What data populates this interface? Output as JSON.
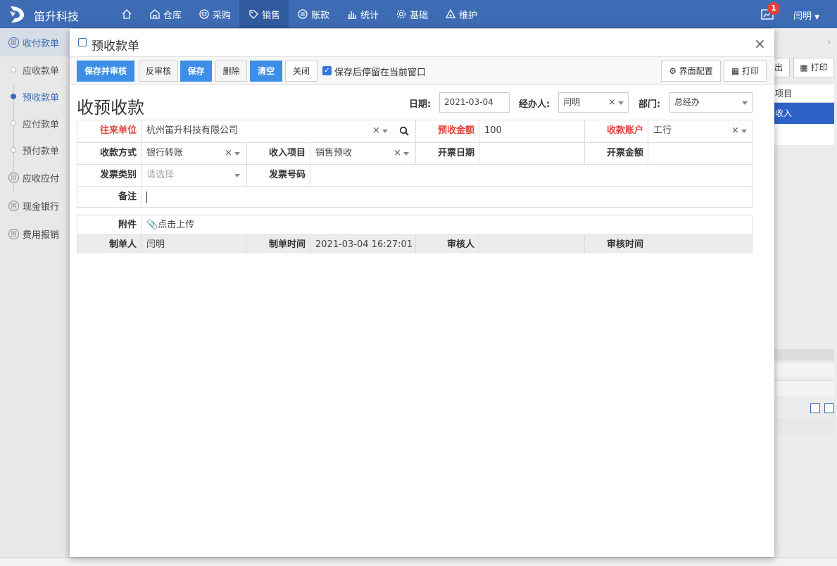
{
  "app": {
    "brand": "笛升科技",
    "badge_count": "1",
    "user_name": "闫明"
  },
  "nav": [
    {
      "label": "",
      "icon": "home-icon"
    },
    {
      "label": "仓库",
      "icon": "warehouse-icon"
    },
    {
      "label": "采购",
      "icon": "purchase-icon"
    },
    {
      "label": "销售",
      "icon": "sales-icon",
      "active": true
    },
    {
      "label": "账款",
      "icon": "account-icon"
    },
    {
      "label": "统计",
      "icon": "stats-icon"
    },
    {
      "label": "基础",
      "icon": "gear-icon"
    },
    {
      "label": "维护",
      "icon": "maintain-icon"
    }
  ],
  "sidebar": {
    "groups": [
      {
        "label": "收付款单",
        "icon_text": "囯"
      },
      {
        "label": "应收应付",
        "icon_text": "囯"
      },
      {
        "label": "现金银行",
        "icon_text": "囯"
      },
      {
        "label": "费用报销",
        "icon_text": "囯"
      }
    ],
    "sub_items": [
      {
        "label": "应收款单"
      },
      {
        "label": "预收款单"
      },
      {
        "label": "应付款单"
      },
      {
        "label": "预付款单"
      }
    ]
  },
  "background": {
    "export_label": "出",
    "print_label": "打印",
    "head_label": "项目",
    "selected_label": "收入"
  },
  "dialog": {
    "title": "预收款单",
    "close_glyph": "×",
    "toolbar": {
      "save_and_audit": "保存并审核",
      "unaudit": "反审核",
      "save": "保存",
      "delete": "删除",
      "clear": "清空",
      "close": "关闭",
      "stay_after_save": "保存后停留在当前窗口",
      "stay_after_save_checked": true,
      "ui_config": "界面配置",
      "print": "打印"
    },
    "form_title": "收预收款",
    "header": {
      "date_label": "日期:",
      "date_value": "2021-03-04",
      "handler_label": "经办人:",
      "handler_value": "闫明",
      "dept_label": "部门:",
      "dept_value": "总经办"
    },
    "fields": {
      "partner_label": "往来单位",
      "partner_value": "杭州笛升科技有限公司",
      "amount_label": "预收金额",
      "amount_value": "100",
      "account_label": "收款账户",
      "account_value": "工行",
      "method_label": "收款方式",
      "method_value": "银行转账",
      "income_label": "收入项目",
      "income_value": "销售预收",
      "invoice_date_label": "开票日期",
      "invoice_date_value": "",
      "invoice_amount_label": "开票金额",
      "invoice_amount_value": "",
      "invoice_type_label": "发票类别",
      "invoice_type_placeholder": "请选择",
      "invoice_no_label": "发票号码",
      "invoice_no_value": "",
      "remark_label": "备注",
      "remark_value": ""
    },
    "footer": {
      "attach_label": "附件",
      "upload_label": "点击上传",
      "creator_label": "制单人",
      "creator_value": "闫明",
      "created_time_label": "制单时间",
      "created_time_value": "2021-03-04 16:27:01",
      "auditor_label": "审核人",
      "auditor_value": "",
      "audit_time_label": "审核时间",
      "audit_time_value": ""
    }
  },
  "colors": {
    "topbar": "#3d6cb5",
    "primary_button": "#3d8ee6",
    "required_label": "#e0413c",
    "selected_row": "#2f62c8"
  }
}
